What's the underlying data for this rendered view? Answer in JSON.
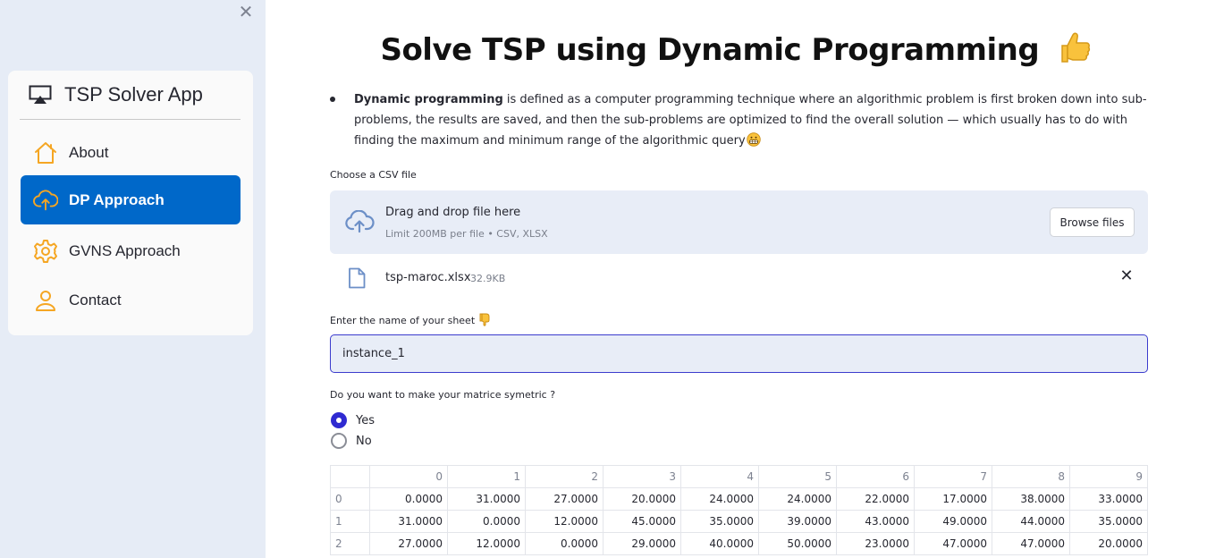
{
  "sidebar": {
    "close_icon": "close-icon",
    "app_title": "TSP Solver App",
    "items": [
      {
        "label": "About",
        "icon": "house-icon",
        "active": false
      },
      {
        "label": "DP Approach",
        "icon": "cloud-upload-icon",
        "active": true
      },
      {
        "label": "GVNS Approach",
        "icon": "gear-icon",
        "active": false
      },
      {
        "label": "Contact",
        "icon": "person-icon",
        "active": false
      }
    ],
    "colors": {
      "active_bg": "#0068c9",
      "icon": "#f5a623",
      "bg": "#e6ecf6"
    }
  },
  "main": {
    "title": "Solve TSP using Dynamic Programming",
    "intro_bold": "Dynamic programming",
    "intro_text": " is defined as a computer programming technique where an algorithmic problem is first broken down into sub-problems, the results are saved, and then the sub-problems are optimized to find the overall solution — which usually has to do with finding the maximum and minimum range of the algorithmic query",
    "upload_label": "Choose a CSV file",
    "dropzone": {
      "title": "Drag and drop file here",
      "limit": "Limit 200MB per file • CSV, XLSX",
      "browse_label": "Browse files"
    },
    "uploaded_file": {
      "name": "tsp-maroc.xlsx",
      "size": "32.9KB"
    },
    "sheet_label": "Enter the name of your sheet",
    "sheet_value": "instance_1",
    "symmetric_label": "Do you want to make your matrice symetric ?",
    "radio_options": [
      {
        "label": "Yes",
        "checked": true
      },
      {
        "label": "No",
        "checked": false
      }
    ],
    "table": {
      "columns": [
        "0",
        "1",
        "2",
        "3",
        "4",
        "5",
        "6",
        "7",
        "8",
        "9"
      ],
      "rows": [
        {
          "index": "0",
          "cells": [
            "0.0000",
            "31.0000",
            "27.0000",
            "20.0000",
            "24.0000",
            "24.0000",
            "22.0000",
            "17.0000",
            "38.0000",
            "33.0000"
          ]
        },
        {
          "index": "1",
          "cells": [
            "31.0000",
            "0.0000",
            "12.0000",
            "45.0000",
            "35.0000",
            "39.0000",
            "43.0000",
            "49.0000",
            "44.0000",
            "35.0000"
          ]
        },
        {
          "index": "2",
          "cells": [
            "27.0000",
            "12.0000",
            "0.0000",
            "29.0000",
            "40.0000",
            "50.0000",
            "23.0000",
            "47.0000",
            "47.0000",
            "20.0000"
          ]
        }
      ]
    }
  }
}
